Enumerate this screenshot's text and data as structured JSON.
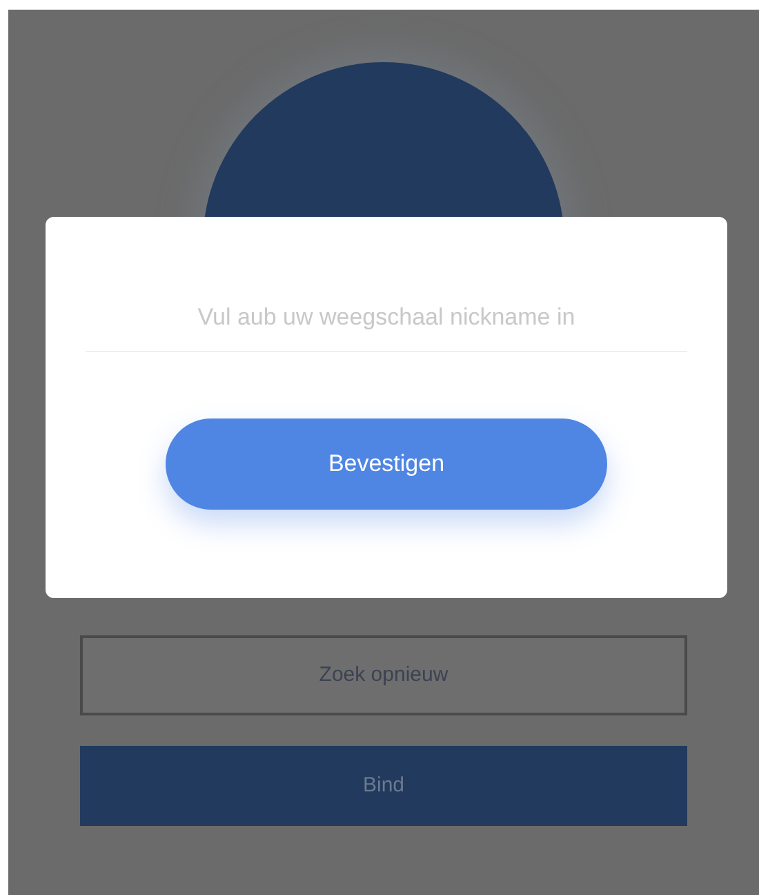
{
  "background": {
    "search_again_button": "Zoek opnieuw",
    "bind_button": "Bind"
  },
  "dialog": {
    "nickname_field": {
      "placeholder": "Vul aub uw weegschaal nickname in"
    },
    "confirm_button": "Bevestigen"
  }
}
